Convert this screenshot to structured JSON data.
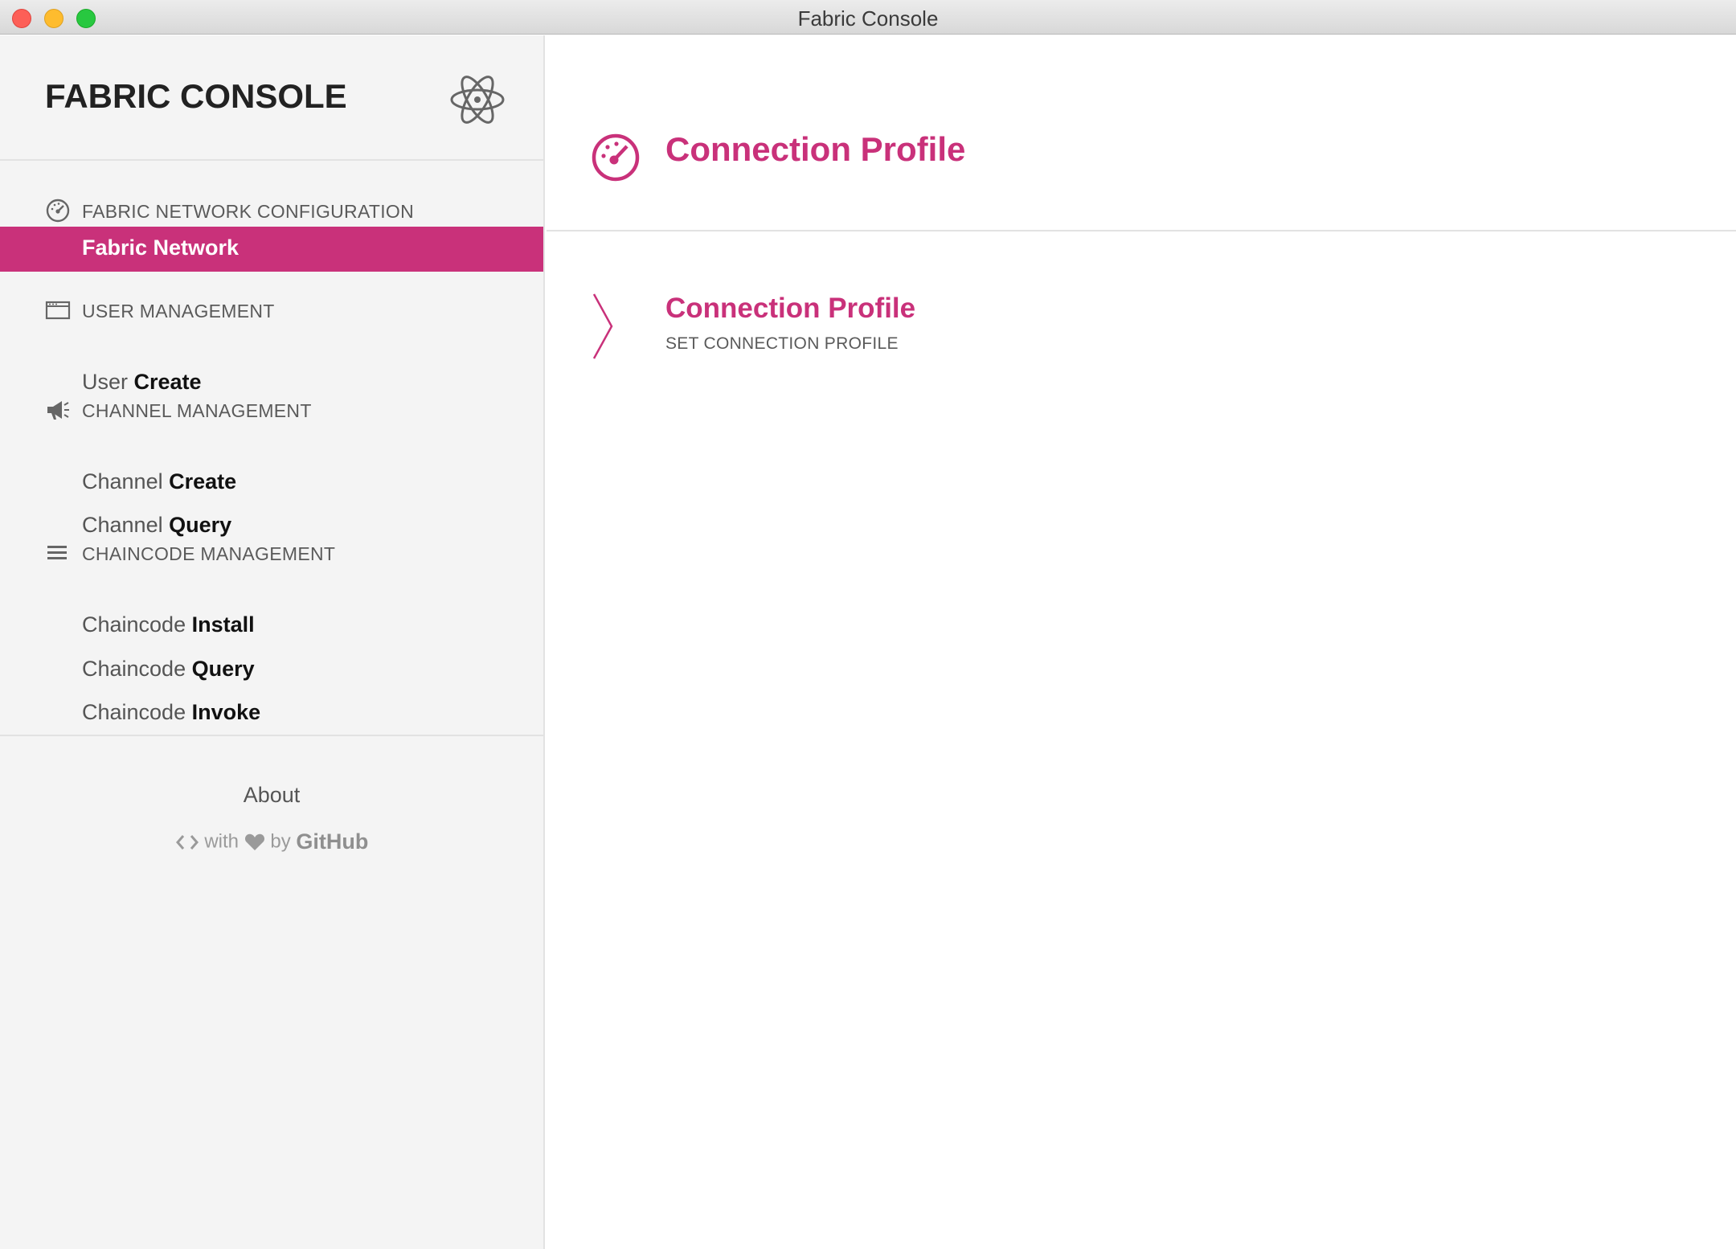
{
  "window": {
    "title": "Fabric Console"
  },
  "sidebar": {
    "brand": "FABRIC CONSOLE",
    "sections": [
      {
        "icon": "dashboard-gauge-icon",
        "title": "FABRIC NETWORK CONFIGURATION",
        "items": [
          {
            "prefix": "",
            "bold": "Fabric Network",
            "active": true
          }
        ]
      },
      {
        "icon": "window-icon",
        "title": "USER MANAGEMENT",
        "items": [
          {
            "prefix": "User ",
            "bold": "Create",
            "active": false
          }
        ]
      },
      {
        "icon": "megaphone-icon",
        "title": "CHANNEL MANAGEMENT",
        "items": [
          {
            "prefix": "Channel ",
            "bold": "Create",
            "active": false
          },
          {
            "prefix": "Channel ",
            "bold": "Query",
            "active": false
          }
        ]
      },
      {
        "icon": "list-icon",
        "title": "CHAINCODE MANAGEMENT",
        "items": [
          {
            "prefix": "Chaincode ",
            "bold": "Install",
            "active": false
          },
          {
            "prefix": "Chaincode ",
            "bold": "Query",
            "active": false
          },
          {
            "prefix": "Chaincode ",
            "bold": "Invoke",
            "active": false
          }
        ]
      }
    ],
    "about": "About",
    "credit": {
      "with": "with",
      "by": "by",
      "github": "GitHub"
    }
  },
  "main": {
    "header_icon": "dashboard-gauge-icon",
    "title": "Connection Profile",
    "card": {
      "title": "Connection Profile",
      "subtitle": "SET CONNECTION PROFILE"
    }
  },
  "colors": {
    "accent": "#c9317a",
    "sidebar_bg": "#f4f4f4"
  }
}
